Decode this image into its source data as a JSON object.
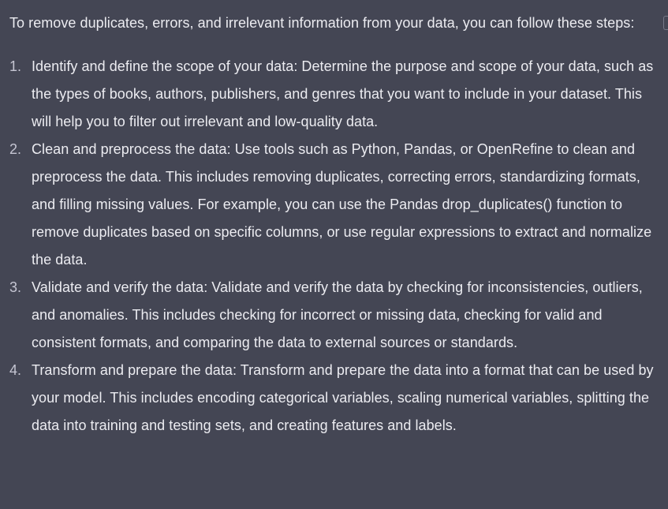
{
  "message": {
    "intro": "To remove duplicates, errors, and irrelevant information from your data, you can follow these steps:",
    "steps": [
      {
        "number": "1.",
        "text": "Identify and define the scope of your data: Determine the purpose and scope of your data, such as the types of books, authors, publishers, and genres that you want to include in your dataset. This will help you to filter out irrelevant and low-quality data."
      },
      {
        "number": "2.",
        "text": "Clean and preprocess the data: Use tools such as Python, Pandas, or OpenRefine to clean and preprocess the data. This includes removing duplicates, correcting errors, standardizing formats, and filling missing values. For example, you can use the Pandas drop_duplicates() function to remove duplicates based on specific columns, or use regular expressions to extract and normalize the data."
      },
      {
        "number": "3.",
        "text": "Validate and verify the data: Validate and verify the data by checking for inconsistencies, outliers, and anomalies. This includes checking for incorrect or missing data, checking for valid and consistent formats, and comparing the data to external sources or standards."
      },
      {
        "number": "4.",
        "text": "Transform and prepare the data: Transform and prepare the data into a format that can be used by your model. This includes encoding categorical variables, scaling numerical variables, splitting the data into training and testing sets, and creating features and labels."
      }
    ]
  },
  "colors": {
    "background": "#444654",
    "text": "#ececf1",
    "list_number": "#c5c5d2"
  },
  "icons": {
    "copy": "copy-icon"
  }
}
